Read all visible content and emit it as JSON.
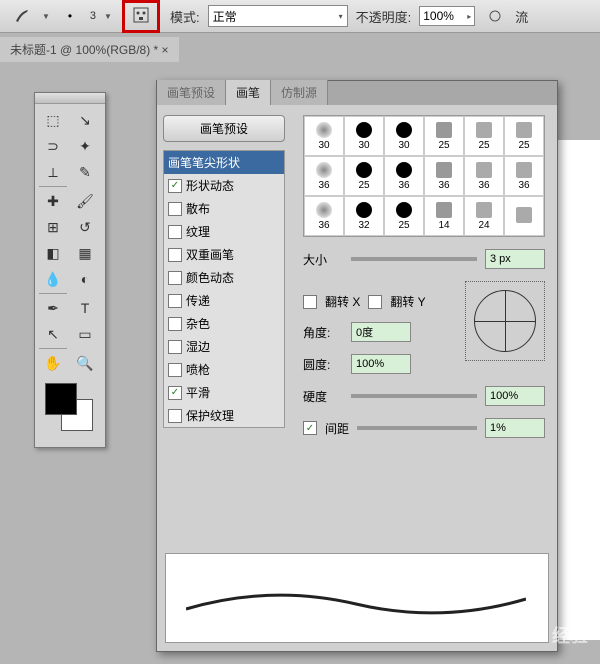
{
  "toolbar": {
    "brush_size": "3",
    "mode_label": "模式:",
    "mode_value": "正常",
    "opacity_label": "不透明度:",
    "opacity_value": "100%",
    "flow_label": "流"
  },
  "doc_tab": "未标题-1 @ 100%(RGB/8) * ×",
  "panel": {
    "tabs": [
      "画笔预设",
      "画笔",
      "仿制源"
    ],
    "preset_btn": "画笔预设",
    "options": [
      {
        "label": "画笔笔尖形状",
        "checked": null,
        "selected": true
      },
      {
        "label": "形状动态",
        "checked": true
      },
      {
        "label": "散布",
        "checked": false
      },
      {
        "label": "纹理",
        "checked": false
      },
      {
        "label": "双重画笔",
        "checked": false
      },
      {
        "label": "颜色动态",
        "checked": false
      },
      {
        "label": "传递",
        "checked": false
      },
      {
        "label": "杂色",
        "checked": false
      },
      {
        "label": "湿边",
        "checked": false
      },
      {
        "label": "喷枪",
        "checked": false
      },
      {
        "label": "平滑",
        "checked": true
      },
      {
        "label": "保护纹理",
        "checked": false
      }
    ],
    "tips": [
      {
        "size": "30"
      },
      {
        "size": "30"
      },
      {
        "size": "30"
      },
      {
        "size": "25"
      },
      {
        "size": "25"
      },
      {
        "size": "25"
      },
      {
        "size": "36"
      },
      {
        "size": "25"
      },
      {
        "size": "36"
      },
      {
        "size": "36"
      },
      {
        "size": "36"
      },
      {
        "size": "36"
      },
      {
        "size": "36"
      },
      {
        "size": "32"
      },
      {
        "size": "25"
      },
      {
        "size": "14"
      },
      {
        "size": "24"
      },
      {
        "size": ""
      }
    ],
    "size_label": "大小",
    "size_value": "3 px",
    "flip_x": "翻转 X",
    "flip_y": "翻转 Y",
    "angle_label": "角度:",
    "angle_value": "0度",
    "round_label": "圆度:",
    "round_value": "100%",
    "hard_label": "硬度",
    "hard_value": "100%",
    "spacing_label": "间距",
    "spacing_value": "1%"
  },
  "watermark": "Baidu 经验"
}
